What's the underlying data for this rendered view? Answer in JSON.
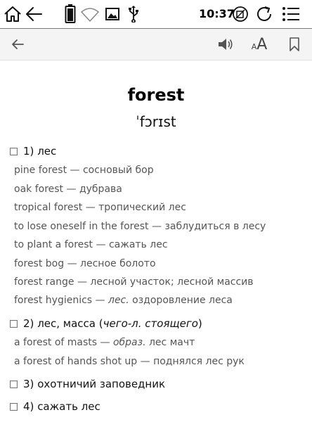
{
  "status_bar": {
    "clock": "10:37",
    "icons": [
      "home-icon",
      "back-arrow-icon",
      "battery-icon",
      "wifi-icon",
      "gallery-icon",
      "usb-icon",
      "sync-lock-icon",
      "refresh-icon",
      "menu-icon"
    ]
  },
  "toolbar": {
    "back_icon": "back-arrow-icon",
    "sound_icon": "speaker-icon",
    "font_size_small": "A",
    "font_size_big": "A",
    "bookmark_icon": "bookmark-icon"
  },
  "entry": {
    "headword": "forest",
    "transcription": "ˈfɔrɪst",
    "senses": [
      {
        "number": "1)",
        "text": "лес",
        "examples": [
          {
            "en": "pine forest",
            "dash": "—",
            "ru": "сосновый бор"
          },
          {
            "en": "oak forest",
            "dash": "—",
            "ru": "дубрава"
          },
          {
            "en": "tropical forest",
            "dash": "—",
            "ru": "тропический лес"
          },
          {
            "en": "to lose oneself in the forest",
            "dash": "—",
            "ru": "заблудиться в лесу"
          },
          {
            "en": "to plant a forest",
            "dash": "—",
            "ru": "сажать лес"
          },
          {
            "en": "forest bog",
            "dash": "—",
            "ru": "лесное болото"
          },
          {
            "en": "forest range",
            "dash": "—",
            "ru": "лесной участок; лесной массив"
          },
          {
            "en": "forest hygienics",
            "dash": "—",
            "label": "лес.",
            "ru": "оздоровление леса"
          }
        ]
      },
      {
        "number": "2)",
        "text": "лес, масса (",
        "note": "чего-л. стоящего",
        "close": ")",
        "examples": [
          {
            "en": "a forest of masts",
            "dash": "—",
            "label": "образ.",
            "ru": "лес мачт"
          },
          {
            "en": "a forest of hands shot up",
            "dash": "—",
            "ru": "поднялся лес рук"
          }
        ]
      },
      {
        "number": "3)",
        "text": "охотничий заповедник"
      },
      {
        "number": "4)",
        "text": "сажать лес"
      }
    ]
  }
}
